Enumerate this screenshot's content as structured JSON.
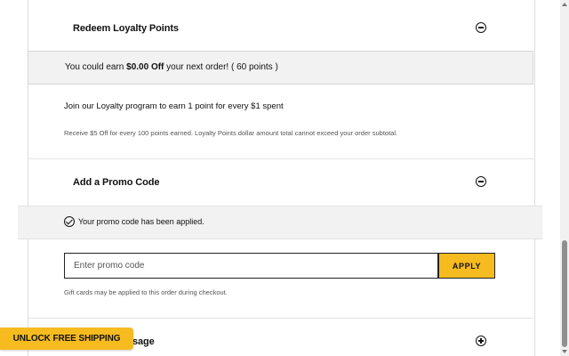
{
  "loyalty": {
    "title": "Redeem Loyalty Points",
    "earn_prefix": "You could earn ",
    "earn_amount": "$0.00 Off",
    "earn_suffix": " your next order! ( 60 points )",
    "join_text": "Join our Loyalty program to earn 1 point for every $1 spent",
    "note": "Receive $5 Off for every 100 points earned. Loyalty Points dollar amount total cannot exceed your order subtotal.",
    "toggle_icon": "minus-circle-icon"
  },
  "promo": {
    "title": "Add a Promo Code",
    "applied_message": "Your promo code has been applied.",
    "input_value": "",
    "input_placeholder": "Enter promo code",
    "apply_label": "APPLY",
    "gift_note": "Gift cards may be applied to this order during checkout.",
    "toggle_icon": "minus-circle-icon",
    "applied_icon": "check-circle-icon"
  },
  "gift_message": {
    "title_visible": "sage",
    "toggle_icon": "plus-circle-icon"
  },
  "banner": {
    "label": "UNLOCK FREE SHIPPING"
  },
  "colors": {
    "accent": "#f5bb1f",
    "panel_bg": "#f2f2f2",
    "text": "#111111"
  }
}
